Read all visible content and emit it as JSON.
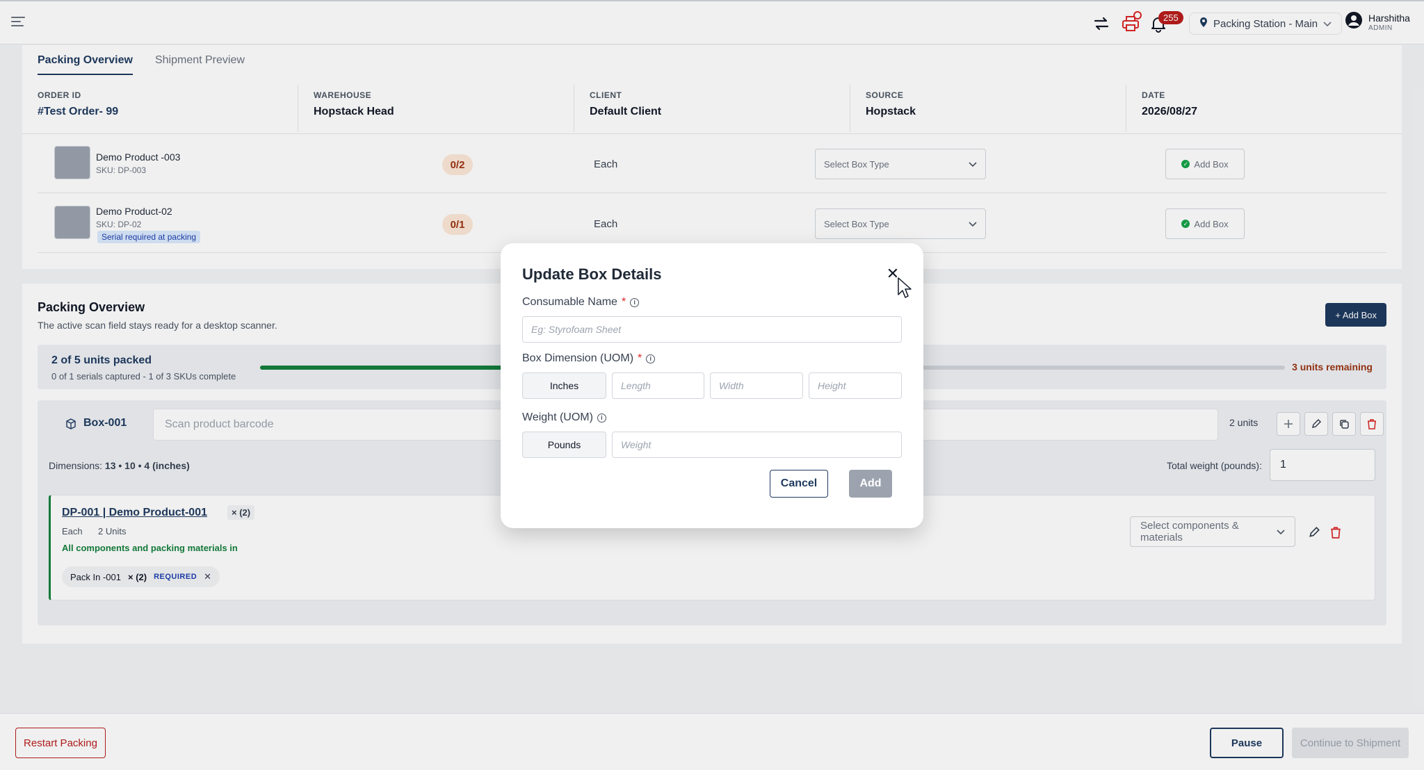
{
  "topbar": {
    "notification_count": "255",
    "station": "Packing Station - Main",
    "user_name": "Harshitha",
    "user_role": "ADMIN"
  },
  "tabs": [
    {
      "label": "Packing Overview",
      "active": true
    },
    {
      "label": "Shipment Preview",
      "active": false
    }
  ],
  "order": {
    "order_id_label": "ORDER ID",
    "order_id": "#Test Order- 99",
    "warehouse_label": "WAREHOUSE",
    "warehouse": "Hopstack Head",
    "client_label": "CLIENT",
    "client": "Default Client",
    "source_label": "SOURCE",
    "source": "Hopstack",
    "date_label": "DATE",
    "date": "2026/08/27"
  },
  "products": [
    {
      "name": "Demo Product -003",
      "sku": "SKU: DP-003",
      "qty": "0/2",
      "uom": "Each",
      "box_type_placeholder": "Select Box Type",
      "add_box": "Add Box"
    },
    {
      "name": "Demo Product-02",
      "sku": "SKU: DP-02",
      "tag": "Serial required at packing",
      "qty": "0/1",
      "uom": "Each",
      "box_type_placeholder": "Select Box Type",
      "add_box": "Add Box"
    }
  ],
  "packing": {
    "title": "Packing Overview",
    "subtitle": "The active scan field stays ready for a desktop scanner.",
    "add_box": "+ Add Box",
    "progress_title": "2 of 5 units packed",
    "progress_sub": "0 of 1 serials captured - 1 of 3 SKUs complete",
    "progress_fraction": 0.4,
    "remaining": "3 units remaining",
    "box_name": "Box-001",
    "scan_placeholder": "Scan product barcode",
    "units": "2 units",
    "dimensions_label": "Dimensions:",
    "dimensions_value": "13 • 10 • 4 (inches)",
    "total_weight_label": "Total weight (pounds):",
    "total_weight_value": "1",
    "item": {
      "title": "DP-001 | Demo Product-001",
      "mult": "× (2)",
      "uom": "Each",
      "units": "2 Units",
      "status": "All components and packing materials in",
      "chip_name": "Pack In -001",
      "chip_mult": "× (2)",
      "chip_required": "REQUIRED",
      "components_placeholder": "Select components & materials"
    }
  },
  "footer": {
    "restart": "Restart Packing",
    "pause": "Pause",
    "continue": "Continue to Shipment"
  },
  "modal": {
    "title": "Update Box Details",
    "consumable_label": "Consumable Name",
    "consumable_placeholder": "Eg: Styrofoam Sheet",
    "dimension_label": "Box Dimension (UOM)",
    "dimension_unit": "Inches",
    "length_placeholder": "Length",
    "width_placeholder": "Width",
    "height_placeholder": "Height",
    "weight_label": "Weight (UOM)",
    "weight_unit": "Pounds",
    "weight_placeholder": "Weight",
    "cancel": "Cancel",
    "add": "Add",
    "required_mark": "*"
  }
}
